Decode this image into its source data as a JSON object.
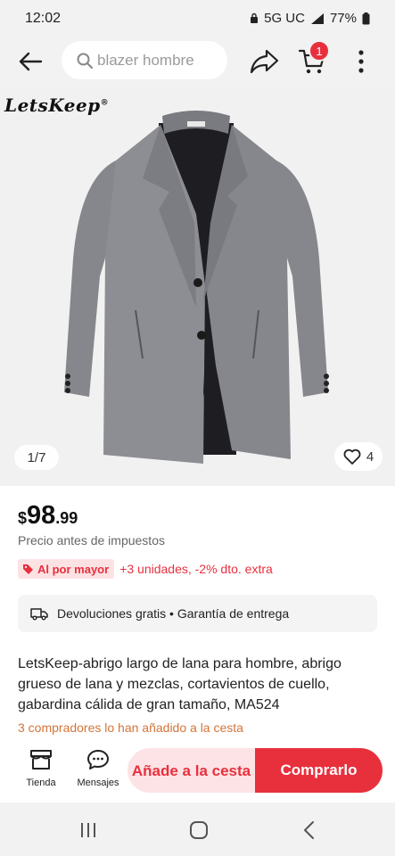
{
  "status_bar": {
    "time": "12:02",
    "network": "5G UC",
    "battery": "77%"
  },
  "nav": {
    "back_icon": "arrow-left-icon",
    "search_placeholder": "blazer hombre",
    "cart_count": "1"
  },
  "gallery": {
    "brand": "LetsKeep",
    "brand_mark": "®",
    "counter": "1/7",
    "likes": "4"
  },
  "product": {
    "currency": "$",
    "price_int": "98",
    "price_dec": ".99",
    "price_note": "Precio antes de impuestos",
    "wholesale_label": "Al por mayor",
    "wholesale_offer": "+3 unidades, -2% dto. extra",
    "services": "Devoluciones gratis • Garantía de entrega",
    "title": "LetsKeep-abrigo largo de lana para hombre, abrigo grueso de lana y mezclas, cortavientos de cuello, gabardina cálida de gran tamaño, MA524",
    "buyers_note": "3 compradores lo han añadido a la cesta"
  },
  "actions": {
    "store_label": "Tienda",
    "messages_label": "Mensajes",
    "add_to_cart": "Añade a la cesta",
    "buy_now": "Comprarlo"
  },
  "colors": {
    "accent": "#e8303d",
    "accent_light": "#fde3e5",
    "buyers_note": "#d4743a"
  }
}
